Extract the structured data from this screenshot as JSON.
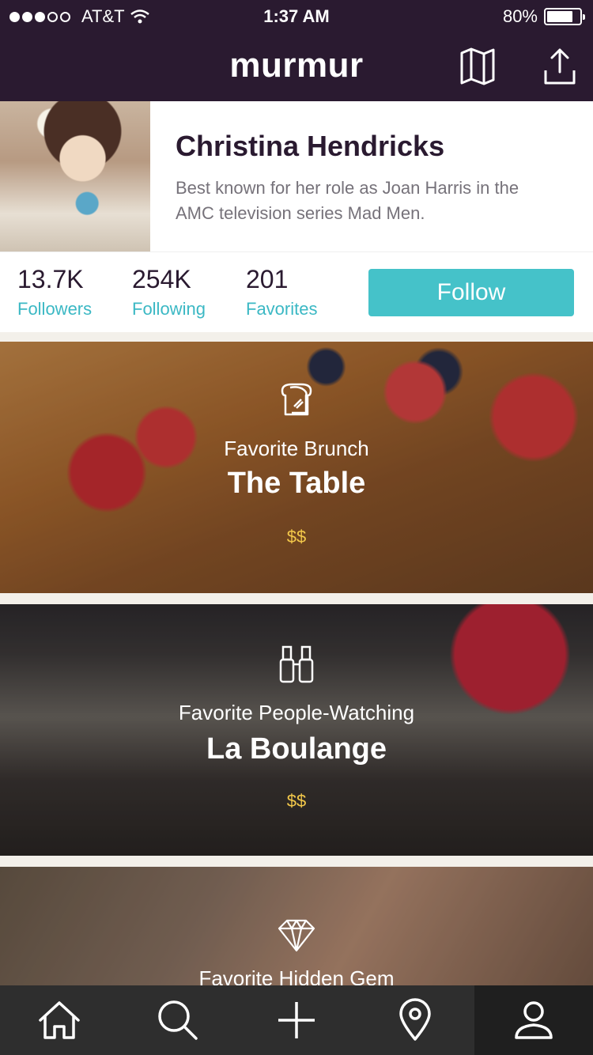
{
  "status_bar": {
    "signal_dots": [
      true,
      true,
      true,
      false,
      false
    ],
    "carrier": "AT&T",
    "time": "1:37 AM",
    "battery_text": "80%",
    "battery_level": 0.8
  },
  "nav": {
    "brand": "murmur",
    "map_icon": "map-icon",
    "share_icon": "share-icon"
  },
  "profile": {
    "name": "Christina Hendricks",
    "bio": "Best known for her role as Joan Harris in the AMC television series Mad Men."
  },
  "stats": [
    {
      "value": "13.7K",
      "label": "Followers"
    },
    {
      "value": "254K",
      "label": "Following"
    },
    {
      "value": "201",
      "label": "Favorites"
    }
  ],
  "follow_label": "Follow",
  "cards": [
    {
      "icon": "toast-icon",
      "category": "Favorite Brunch",
      "place": "The Table",
      "price": "$$"
    },
    {
      "icon": "binoculars-icon",
      "category": "Favorite People-Watching",
      "place": "La Boulange",
      "price": "$$"
    },
    {
      "icon": "diamond-icon",
      "category": "Favorite Hidden Gem"
    }
  ],
  "tabs": [
    "home-icon",
    "search-icon",
    "add-icon",
    "location-pin-icon",
    "profile-icon"
  ],
  "colors": {
    "header_bg": "#2a1a30",
    "accent": "#45c2c9",
    "price": "#f3c84a",
    "tabbar_bg": "#2e2e2e"
  }
}
